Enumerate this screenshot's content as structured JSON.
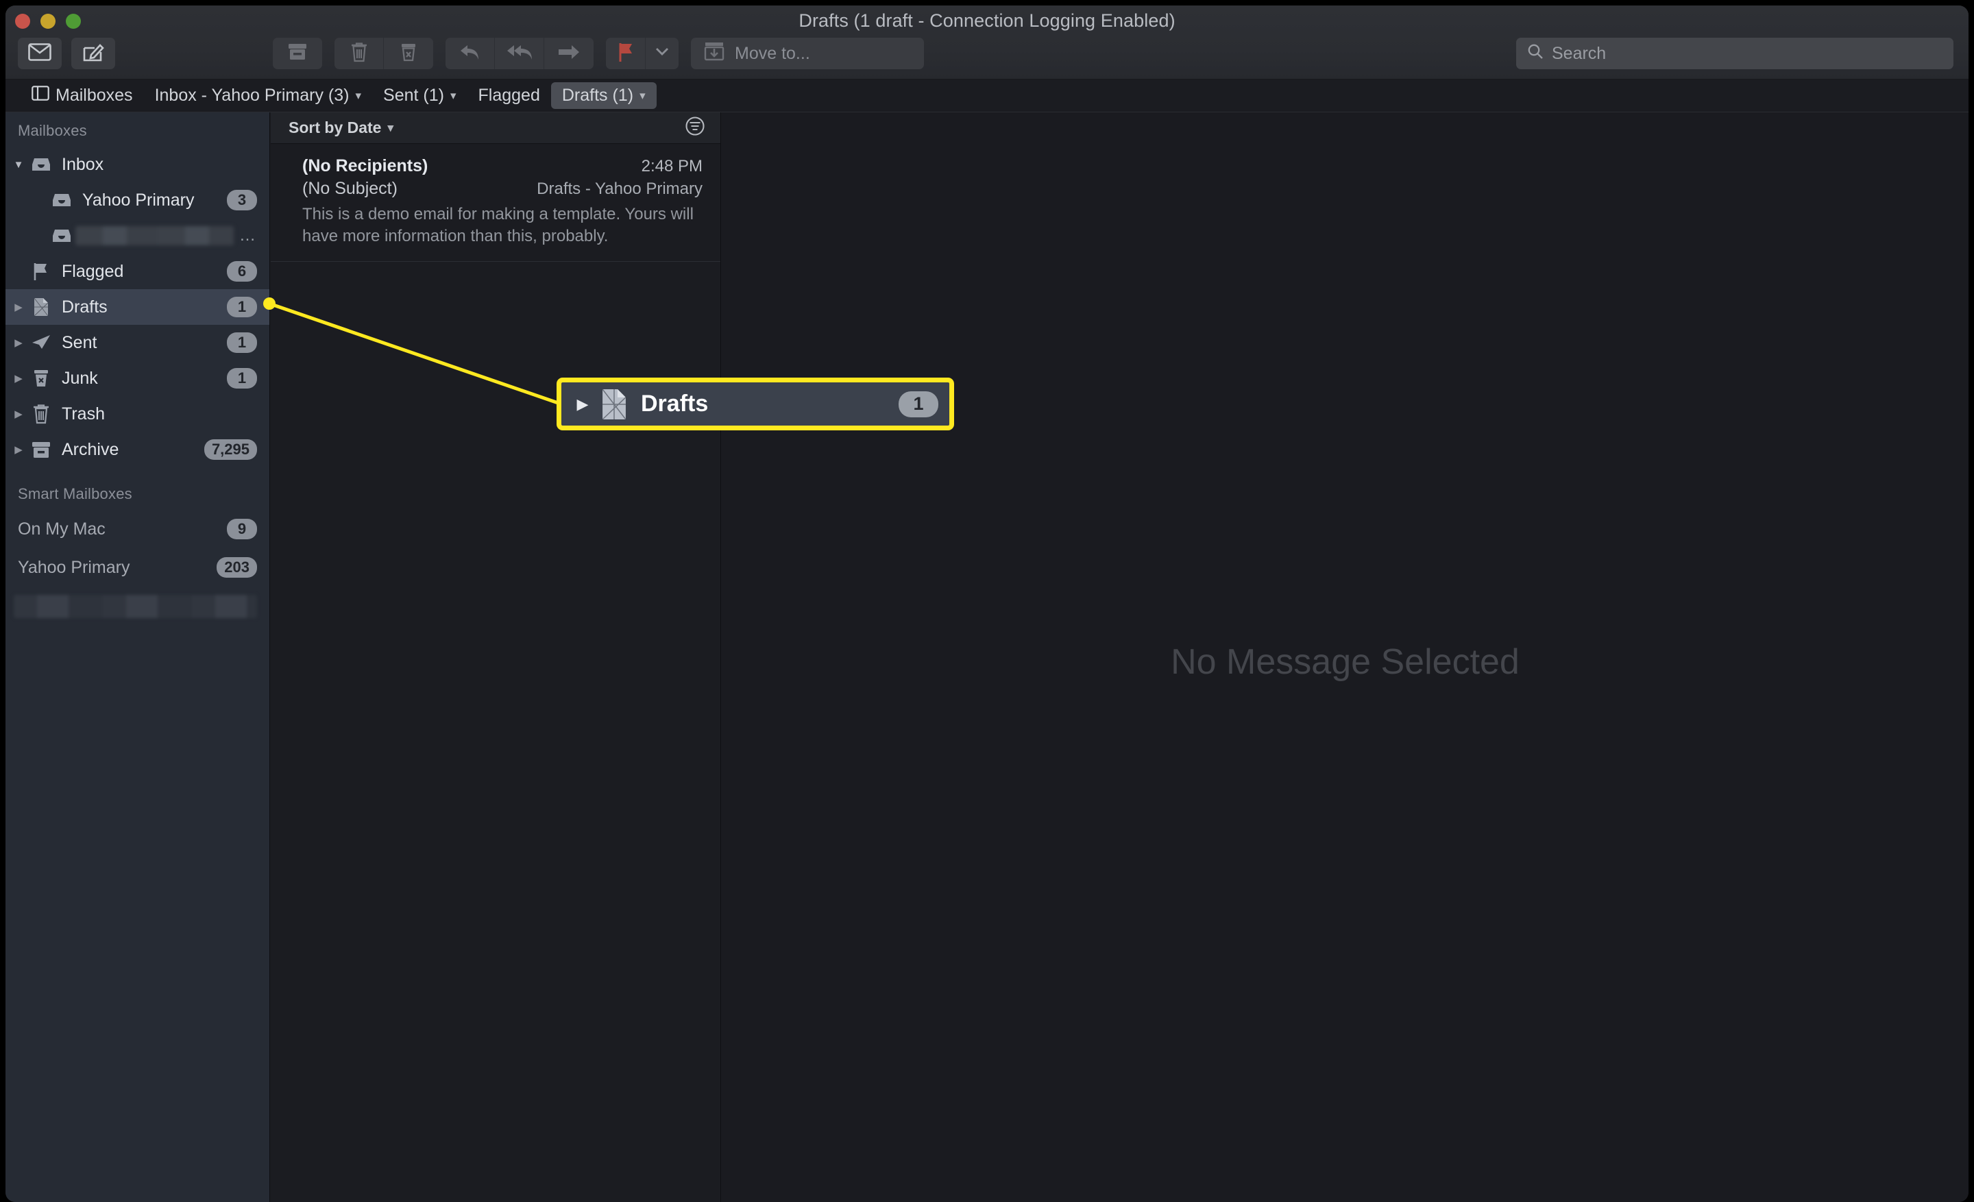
{
  "window": {
    "title": "Drafts (1 draft - Connection Logging Enabled)",
    "traffic": {
      "close": "close-button",
      "minimize": "minimize-button",
      "zoom": "zoom-button"
    }
  },
  "toolbar": {
    "get_mail_label": "mail-icon",
    "compose_label": "compose-icon",
    "archive_label": "archive-icon",
    "delete_label": "trash-icon",
    "junk_label": "junk-icon",
    "reply_label": "reply-icon",
    "reply_all_label": "reply-all-icon",
    "forward_label": "forward-icon",
    "flag_label": "flag-icon",
    "flag_menu_label": "chevron-down-icon",
    "move_to_label": "Move to...",
    "flag_color": "#b5483f"
  },
  "search": {
    "placeholder": "Search",
    "value": ""
  },
  "favorites": {
    "mailboxes_label": "Mailboxes",
    "items": [
      {
        "label": "Inbox - Yahoo Primary (3)",
        "chevron": true,
        "selected": false
      },
      {
        "label": "Sent (1)",
        "chevron": true,
        "selected": false
      },
      {
        "label": "Flagged",
        "chevron": false,
        "selected": false
      },
      {
        "label": "Drafts (1)",
        "chevron": true,
        "selected": true
      }
    ]
  },
  "sidebar": {
    "mailboxes_header": "Mailboxes",
    "smart_header": "Smart Mailboxes",
    "mailboxes": [
      {
        "label": "Inbox",
        "icon": "inbox-icon",
        "badge": "",
        "disclosure": "open",
        "indent": false,
        "selected": false,
        "redacted": false
      },
      {
        "label": "Yahoo Primary",
        "icon": "inbox-icon",
        "badge": "3",
        "disclosure": "none",
        "indent": true,
        "selected": false,
        "redacted": false
      },
      {
        "label": "",
        "icon": "inbox-icon",
        "badge": "",
        "disclosure": "none",
        "indent": true,
        "selected": false,
        "redacted": true,
        "ellipsis": "…"
      },
      {
        "label": "Flagged",
        "icon": "flag-icon",
        "badge": "6",
        "disclosure": "none",
        "indent": false,
        "selected": false,
        "redacted": false
      },
      {
        "label": "Drafts",
        "icon": "drafts-icon",
        "badge": "1",
        "disclosure": "closed",
        "indent": false,
        "selected": true,
        "redacted": false
      },
      {
        "label": "Sent",
        "icon": "sent-icon",
        "badge": "1",
        "disclosure": "closed",
        "indent": false,
        "selected": false,
        "redacted": false
      },
      {
        "label": "Junk",
        "icon": "junk-icon",
        "badge": "1",
        "disclosure": "closed",
        "indent": false,
        "selected": false,
        "redacted": false
      },
      {
        "label": "Trash",
        "icon": "trash-icon",
        "badge": "",
        "disclosure": "closed",
        "indent": false,
        "selected": false,
        "redacted": false
      },
      {
        "label": "Archive",
        "icon": "archive-icon",
        "badge": "7,295",
        "disclosure": "closed",
        "indent": false,
        "selected": false,
        "redacted": false
      }
    ],
    "smart_mailboxes": [
      {
        "label": "On My Mac",
        "badge": "9"
      },
      {
        "label": "Yahoo Primary",
        "badge": "203"
      }
    ]
  },
  "message_list": {
    "sort_label": "Sort by Date",
    "filter_icon": "filter-icon",
    "messages": [
      {
        "from": "(No Recipients)",
        "time": "2:48 PM",
        "subject": "(No Subject)",
        "mailbox": "Drafts - Yahoo Primary",
        "preview": "This is a demo email for making a template. Yours will have more information than this, probably."
      }
    ]
  },
  "reading_pane": {
    "empty_state": "No Message Selected"
  },
  "callout": {
    "label": "Drafts",
    "badge": "1",
    "icon": "drafts-icon",
    "disclosure": "closed",
    "highlight_color": "#ffe920"
  }
}
